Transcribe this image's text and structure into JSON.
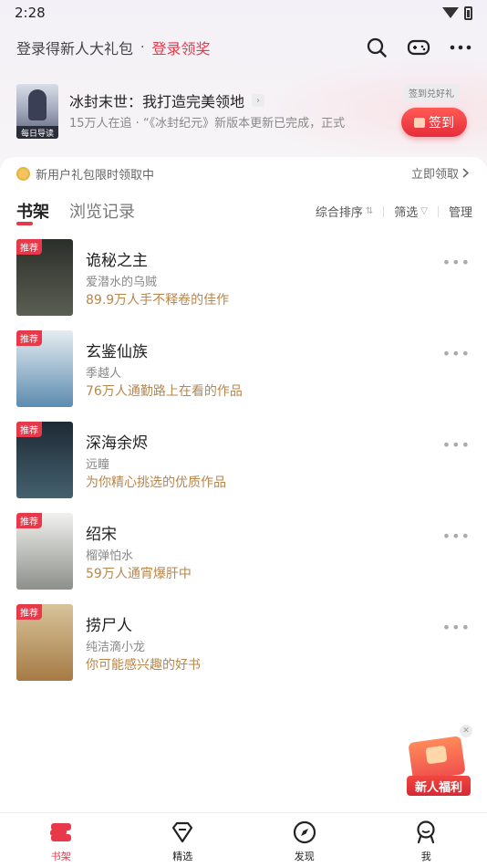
{
  "status_bar": {
    "time": "2:28"
  },
  "header": {
    "login_prompt": "登录得新人大礼包",
    "separator": "·",
    "login_link": "登录领奖",
    "icons": [
      "search-icon",
      "gamepad-icon",
      "more-icon"
    ]
  },
  "promo": {
    "cover_tag": "每日导读",
    "title": "冰封末世：我打造完美领地",
    "subtitle": "15万人在追 · “《冰封纪元》新版本更新已完成，正式",
    "badge": "签到兑好礼",
    "signin_label": "签到"
  },
  "newbie_bar": {
    "text": "新用户礼包限时领取中",
    "link": "立即领取"
  },
  "tabs": {
    "shelf": "书架",
    "history": "浏览记录"
  },
  "tools": {
    "sort": "综合排序",
    "sort_mark": "⇅",
    "filter": "筛选",
    "filter_mark": "▽",
    "manage": "管理"
  },
  "books": [
    {
      "tag": "推荐",
      "title": "诡秘之主",
      "author": "爱潜水的乌贼",
      "desc": "89.9万人手不释卷的佳作",
      "cover_colors": [
        "#2b2f2a",
        "#5a5f53"
      ]
    },
    {
      "tag": "推荐",
      "title": "玄鉴仙族",
      "author": "季越人",
      "desc": "76万人通勤路上在看的作品",
      "cover_colors": [
        "#e6ecf0",
        "#5c8cb0"
      ]
    },
    {
      "tag": "推荐",
      "title": "深海余烬",
      "author": "远瞳",
      "desc": "为你精心挑选的优质作品",
      "cover_colors": [
        "#1d2a35",
        "#45606e"
      ]
    },
    {
      "tag": "推荐",
      "title": "绍宋",
      "author": "榴弹怕水",
      "desc": "59万人通宵爆肝中",
      "cover_colors": [
        "#f1f1ee",
        "#8c8f8a"
      ]
    },
    {
      "tag": "推荐",
      "title": "捞尸人",
      "author": "纯洁滴小龙",
      "desc": "你可能感兴趣的好书",
      "cover_colors": [
        "#d8c39a",
        "#a57b45"
      ]
    }
  ],
  "float_badge": {
    "label": "新人福利",
    "close": "✕"
  },
  "bottom_nav": [
    {
      "label": "书架",
      "icon": "bookshelf-icon",
      "active": true
    },
    {
      "label": "精选",
      "icon": "diamond-icon",
      "active": false
    },
    {
      "label": "发现",
      "icon": "compass-icon",
      "active": false
    },
    {
      "label": "我",
      "icon": "profile-icon",
      "active": false
    }
  ],
  "accent_color": "#e8394a"
}
